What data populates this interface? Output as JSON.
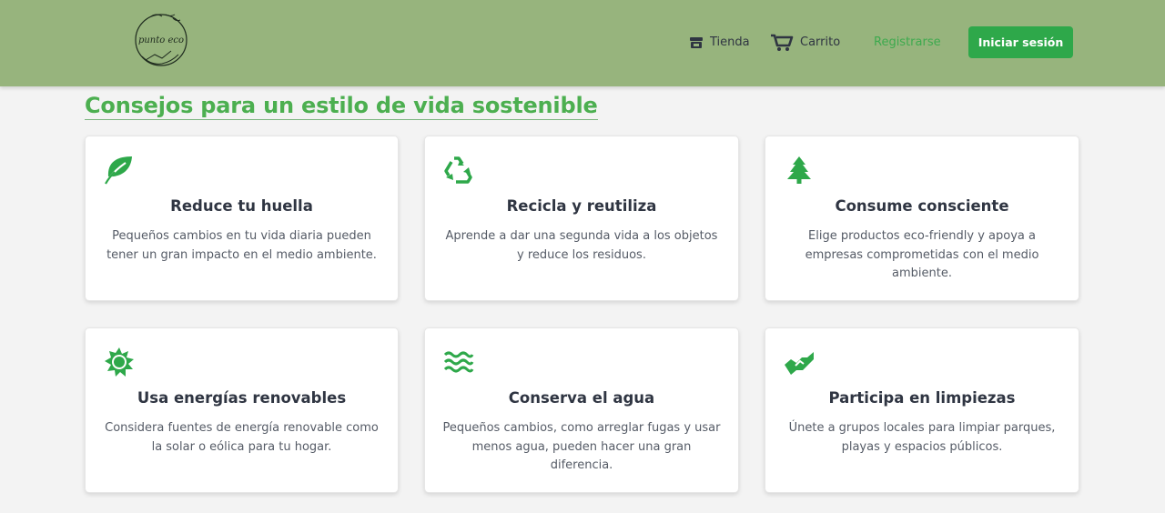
{
  "header": {
    "logo_text": "punto eco",
    "nav": {
      "tienda": "Tienda",
      "carrito": "Carrito",
      "registrarse": "Registrarse"
    },
    "login_button": "Iniciar sesión"
  },
  "main": {
    "title": "Consejos para un estilo de vida sostenible",
    "cards": [
      {
        "icon": "leaf-icon",
        "title": "Reduce tu huella",
        "text": "Pequeños cambios en tu vida diaria pueden tener un gran impacto en el medio ambiente."
      },
      {
        "icon": "recycle-icon",
        "title": "Recicla y reutiliza",
        "text": "Aprende a dar una segunda vida a los objetos y reduce los residuos."
      },
      {
        "icon": "tree-icon",
        "title": "Consume consciente",
        "text": "Elige productos eco-friendly y apoya a empresas comprometidas con el medio ambiente."
      },
      {
        "icon": "sun-icon",
        "title": "Usa energías renovables",
        "text": "Considera fuentes de energía renovable como la solar o eólica para tu hogar."
      },
      {
        "icon": "water-icon",
        "title": "Conserva el agua",
        "text": "Pequeños cambios, como arreglar fugas y usar menos agua, pueden hacer una gran diferencia."
      },
      {
        "icon": "handshake-icon",
        "title": "Participa en limpiezas",
        "text": "Únete a grupos locales para limpiar parques, playas y espacios públicos."
      }
    ]
  },
  "colors": {
    "header_bg": "#97b47d",
    "accent": "#2ea84a",
    "title": "#4caf50",
    "text": "#2f3542"
  }
}
